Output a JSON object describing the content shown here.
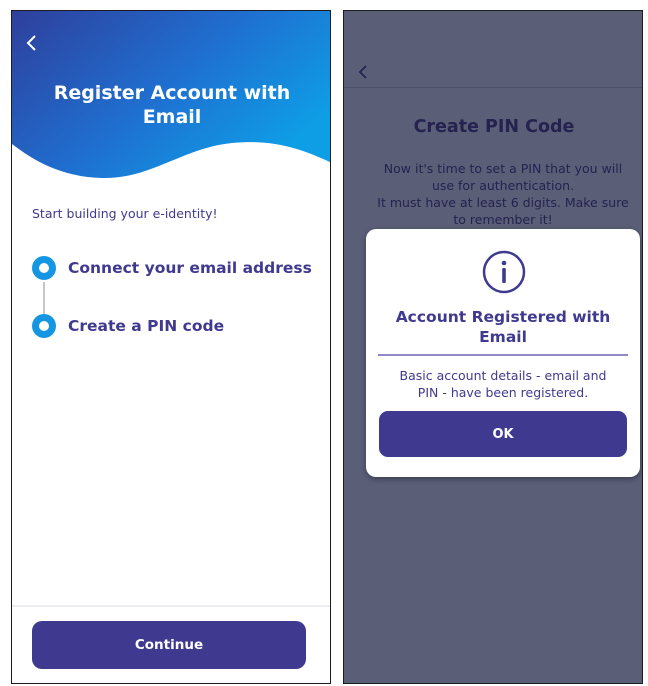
{
  "left_screen": {
    "title_line1": "Register Account with",
    "title_line2": "Email",
    "intro": "Start building your e-identity!",
    "steps": [
      {
        "label": "Connect your email address"
      },
      {
        "label": "Create a PIN code"
      }
    ],
    "continue_label": "Continue",
    "icons": {
      "back": "chevron-left-icon"
    }
  },
  "right_screen": {
    "title": "Create PIN Code",
    "description_lines": [
      "Now it's time to set a PIN that you will",
      "use for authentication.",
      "It must have at least 6 digits. Make sure",
      "to remember it!"
    ],
    "dialog": {
      "title_line1": "Account Registered with",
      "title_line2": "Email",
      "body_line1": "Basic account details - email and",
      "body_line2": "PIN - have been registered.",
      "ok_label": "OK",
      "icon": "info-icon"
    },
    "icons": {
      "back": "chevron-left-icon"
    }
  },
  "colors": {
    "brand": "#3f3a8f",
    "accent_blue": "#1596e3",
    "overlay": "#5a5e77",
    "gradient_start": "#2f3f9c",
    "gradient_end": "#0e9ee6"
  }
}
